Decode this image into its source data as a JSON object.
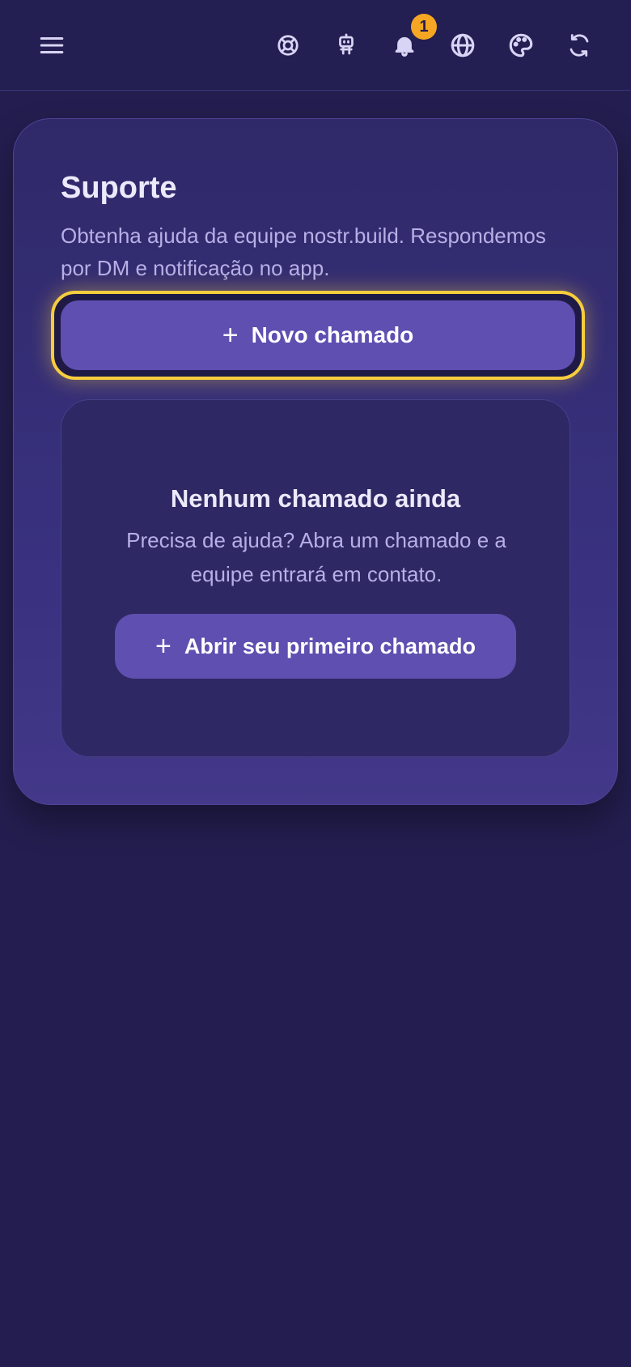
{
  "header": {
    "icons": [
      "menu-icon",
      "lifebuoy-icon",
      "robot-icon",
      "bell-icon",
      "globe-icon",
      "palette-icon",
      "refresh-icon"
    ],
    "notification_count": "1"
  },
  "support": {
    "title": "Suporte",
    "description": "Obtenha ajuda da equipe nostr.build. Respondemos por DM e notificação no app.",
    "new_ticket_label": "Novo chamado",
    "empty_title": "Nenhum chamado ainda",
    "empty_description": "Precisa de ajuda? Abra um chamado e a equipe entrará em contato.",
    "first_ticket_label": "Abrir seu primeiro chamado"
  },
  "colors": {
    "background": "#231e4f",
    "accent": "#5f4fb0",
    "focus_ring": "#f6cd3d",
    "badge": "#f5a623"
  }
}
